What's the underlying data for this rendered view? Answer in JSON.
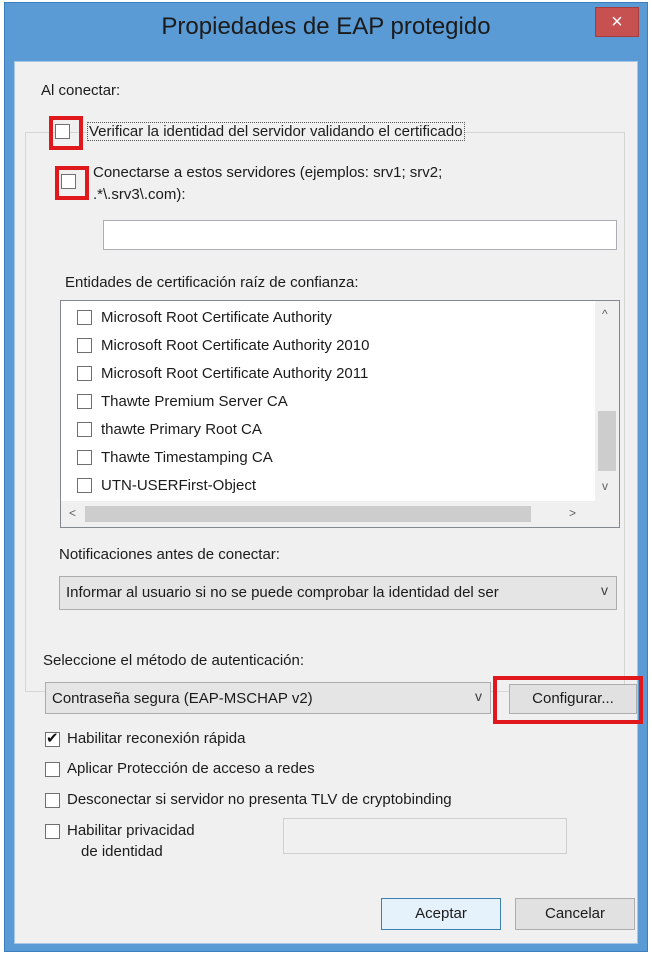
{
  "window": {
    "title": "Propiedades de EAP protegido",
    "close_glyph": "×"
  },
  "connect": {
    "heading": "Al conectar:",
    "verify_server": {
      "label": "Verificar la identidad del servidor validando el certificado",
      "checked": false
    },
    "connect_servers": {
      "label_line1": "Conectarse a estos servidores (ejemplos: srv1; srv2;",
      "label_line2": ".*\\.srv3\\.com):",
      "checked": false
    },
    "servers_value": ""
  },
  "trusted_root": {
    "label": "Entidades de certificación raíz de confianza:",
    "items": [
      {
        "name": "Microsoft Root Certificate Authority",
        "checked": false
      },
      {
        "name": "Microsoft Root Certificate Authority 2010",
        "checked": false
      },
      {
        "name": "Microsoft Root Certificate Authority 2011",
        "checked": false
      },
      {
        "name": "Thawte Premium Server CA",
        "checked": false
      },
      {
        "name": "thawte Primary Root CA",
        "checked": false
      },
      {
        "name": "Thawte Timestamping CA",
        "checked": false
      },
      {
        "name": "UTN-USERFirst-Object",
        "checked": false
      }
    ]
  },
  "notifications": {
    "label": "Notificaciones antes de conectar:",
    "selected": "Informar al usuario si no se puede comprobar la identidad del ser"
  },
  "auth_method": {
    "label": "Seleccione el método de autenticación:",
    "selected": "Contraseña segura (EAP-MSCHAP v2)",
    "configure_button": "Configurar..."
  },
  "options": [
    {
      "label": "Habilitar reconexión rápida",
      "checked": true
    },
    {
      "label": "Aplicar Protección de acceso a redes",
      "checked": false
    },
    {
      "label": "Desconectar si servidor no presenta TLV de cryptobinding",
      "checked": false
    },
    {
      "label_line1": "Habilitar privacidad",
      "label_line2": "de identidad",
      "checked": false
    }
  ],
  "buttons": {
    "ok": "Aceptar",
    "cancel": "Cancelar"
  },
  "icons": {
    "scroll_up": "^",
    "scroll_down": "v",
    "scroll_left": "<",
    "scroll_right": ">",
    "dropdown": "v"
  },
  "colors": {
    "highlight_red": "#e0181c",
    "title_bg": "#5a9bd5",
    "close_bg": "#c75050"
  }
}
